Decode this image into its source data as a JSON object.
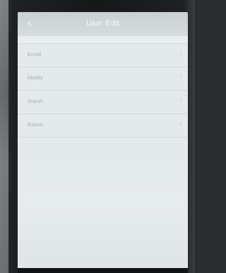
{
  "header": {
    "title": "User Edit",
    "back_icon": "chevron-left-icon"
  },
  "menu": {
    "items": [
      {
        "label": "Enroll",
        "icon": "chevron-right-icon"
      },
      {
        "label": "Modify",
        "icon": "chevron-right-icon"
      },
      {
        "label": "Import",
        "icon": "chevron-right-icon"
      },
      {
        "label": "Export",
        "icon": "chevron-right-icon"
      }
    ]
  },
  "colors": {
    "screen_background": "#e4e9ea",
    "header_background": "#cfd6d9",
    "header_text": "#f6f8f9",
    "item_text": "#a5aeb3",
    "divider": "#d3d9db"
  }
}
